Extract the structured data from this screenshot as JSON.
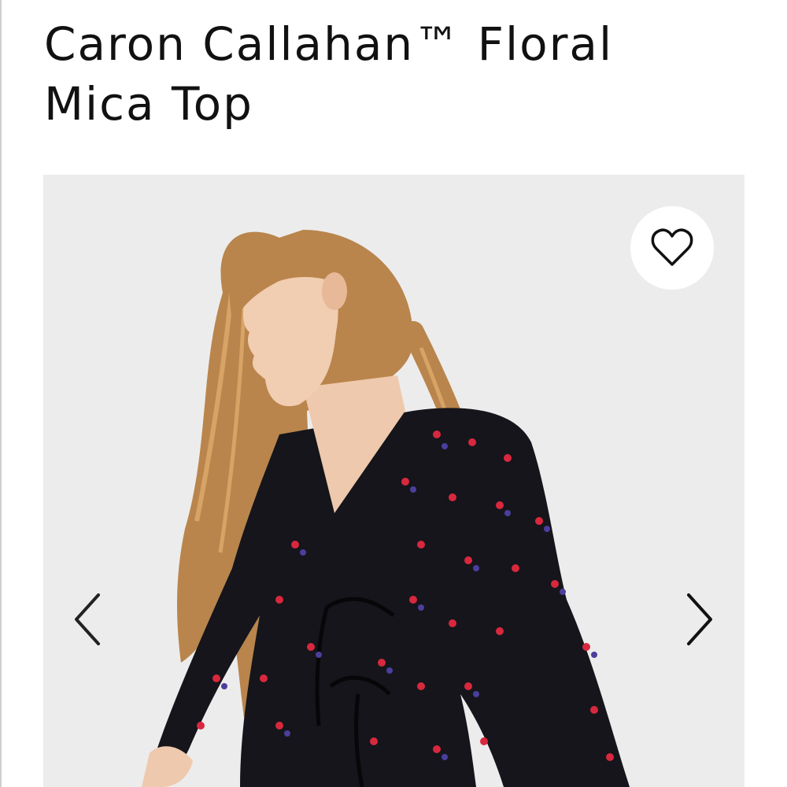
{
  "product": {
    "title": "Caron Callahan™ Floral Mica Top"
  },
  "gallery": {
    "favorite_icon": "heart-outline-icon",
    "prev_icon": "chevron-left-icon",
    "next_icon": "chevron-right-icon",
    "colors": {
      "background": "#ececec",
      "garment": "#15151b",
      "print_red": "#d8283e",
      "print_blue": "#4a3f9c",
      "hair": "#b9854c"
    }
  }
}
